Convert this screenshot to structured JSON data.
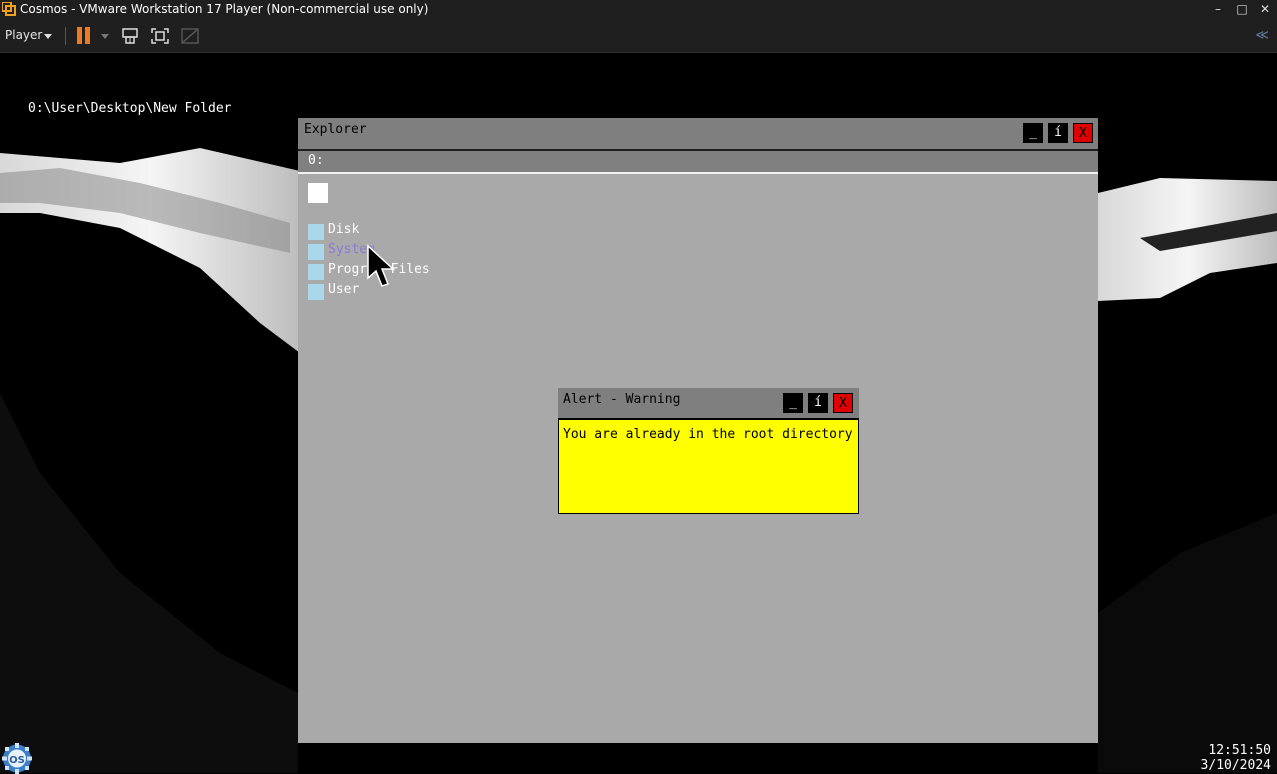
{
  "host": {
    "window_title": "Cosmos - VMware Workstation 17 Player (Non-commercial use only)",
    "player_menu": "Player",
    "window_controls": {
      "minimize": "–",
      "maximize": "□",
      "close": "✕"
    },
    "collapse_label": "≪"
  },
  "guest": {
    "current_path": "0:\\User\\Desktop\\New Folder",
    "explorer": {
      "title": "Explorer",
      "address": "0:",
      "buttons": {
        "minimize": "_",
        "info": "í",
        "close": "X"
      },
      "items": [
        {
          "label": "Disk",
          "selected": false
        },
        {
          "label": "System",
          "selected": true
        },
        {
          "label": "Program Files",
          "selected": false
        },
        {
          "label": "User",
          "selected": false
        }
      ]
    },
    "alert": {
      "title": "Alert - Warning",
      "message": "You are already in the root directory",
      "buttons": {
        "minimize": "_",
        "info": "í",
        "close": "X"
      }
    },
    "taskbar": {
      "logo_text": "OS",
      "time": "12:51:50",
      "date": "3/10/2024"
    }
  },
  "colors": {
    "explorer_bg": "#a9a9a9",
    "titlebar_bg": "#7f7f7f",
    "alert_bg": "#ffff00",
    "close_btn": "#e00000",
    "folder_icon": "#a8d8ea",
    "pause_accent": "#f07a1f",
    "selected_text": "#8a7ad8"
  }
}
